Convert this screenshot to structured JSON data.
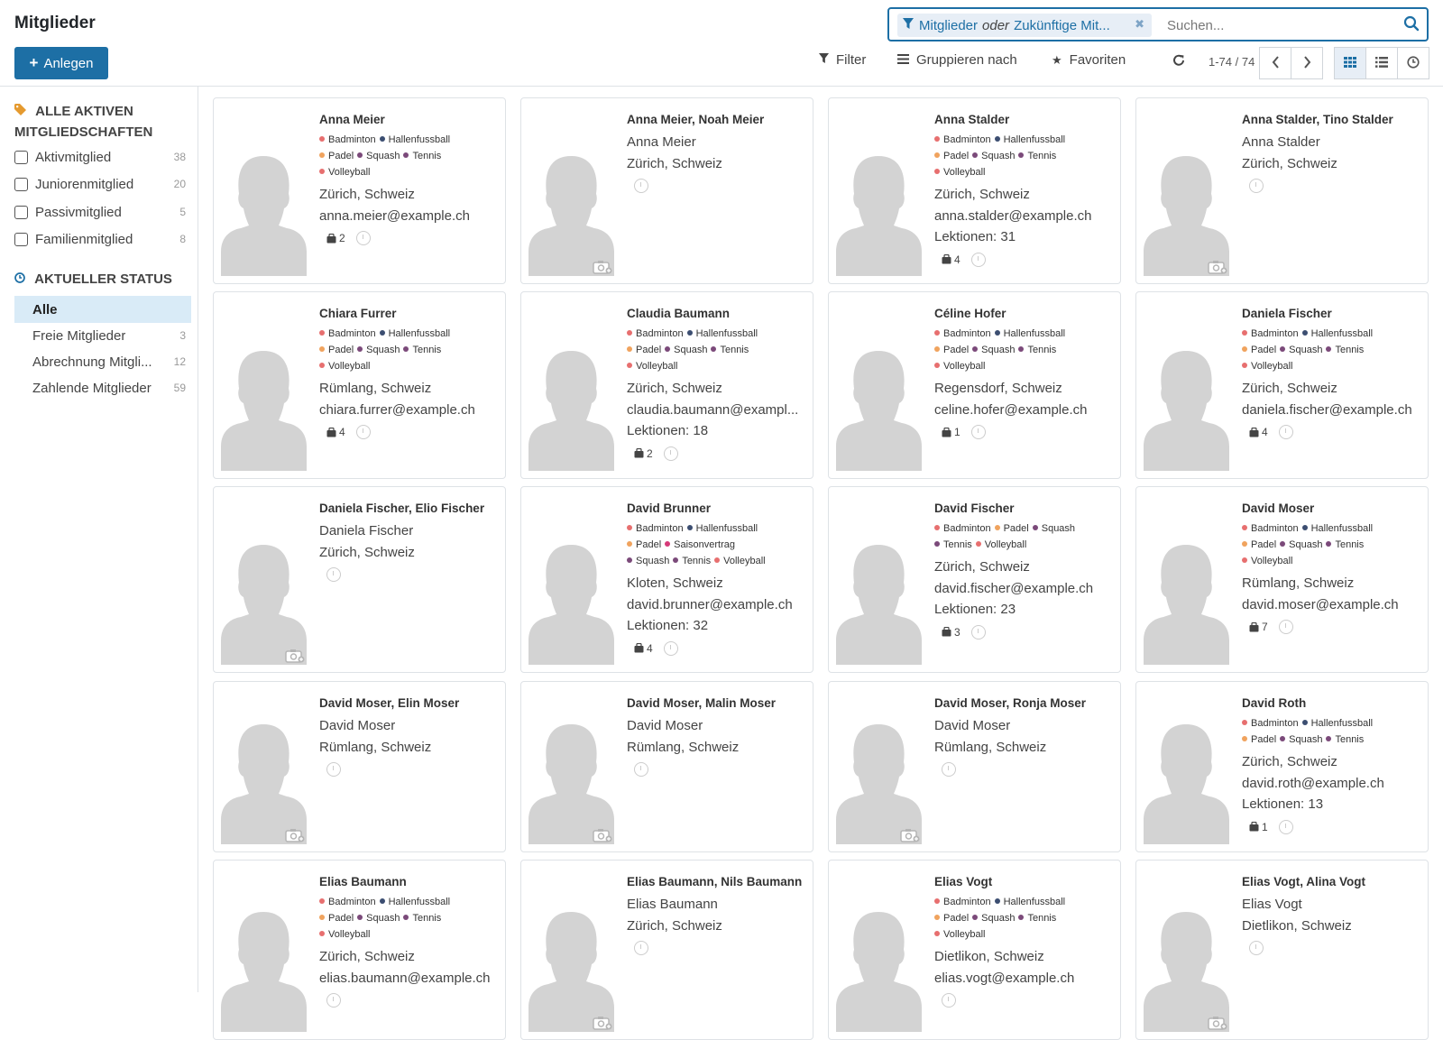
{
  "header": {
    "title": "Mitglieder",
    "create_label": "Anlegen",
    "facet_a": "Mitglieder",
    "facet_or": "oder",
    "facet_b": "Zukünftige Mit...",
    "search_placeholder": "Suchen...",
    "filter_label": "Filter",
    "group_label": "Gruppieren nach",
    "favorites_label": "Favoriten",
    "pager_value": "1-74 / 74"
  },
  "colors": {
    "accent": "#1d6fa5",
    "tag_red": "#e76f6f",
    "tag_orange": "#f0a35e",
    "tag_purple": "#7b4a7a",
    "tag_navy": "#3c4e71",
    "tag_magenta": "#d63a78"
  },
  "sidebar": {
    "memberships_title_1": "ALLE AKTIVEN",
    "memberships_title_2": "MITGLIEDSCHAFTEN",
    "memberships": [
      {
        "label": "Aktivmitglied",
        "count": "38"
      },
      {
        "label": "Juniorenmitglied",
        "count": "20"
      },
      {
        "label": "Passivmitglied",
        "count": "5"
      },
      {
        "label": "Familienmitglied",
        "count": "8"
      }
    ],
    "status_title": "AKTUELLER STATUS",
    "statuses": [
      {
        "label": "Alle",
        "count": ""
      },
      {
        "label": "Freie Mitglieder",
        "count": "3"
      },
      {
        "label": "Abrechnung Mitgli...",
        "count": "12"
      },
      {
        "label": "Zahlende Mitglieder",
        "count": "59"
      }
    ]
  },
  "cards": [
    {
      "name": "Anna Meier",
      "tags": [
        "Badminton",
        "Hallenfussball",
        "Padel",
        "Squash",
        "Tennis",
        "Volleyball"
      ],
      "lines": [
        "Zürich, Schweiz",
        "anna.meier@example.ch"
      ],
      "bag": "2",
      "camera": false
    },
    {
      "name": "Anna Meier, Noah Meier",
      "tags": [],
      "lines": [
        "Anna Meier",
        "Zürich, Schweiz"
      ],
      "bag": "",
      "camera": true
    },
    {
      "name": "Anna Stalder",
      "tags": [
        "Badminton",
        "Hallenfussball",
        "Padel",
        "Squash",
        "Tennis",
        "Volleyball"
      ],
      "lines": [
        "Zürich, Schweiz",
        "anna.stalder@example.ch",
        "Lektionen: 31"
      ],
      "bag": "4",
      "camera": false
    },
    {
      "name": "Anna Stalder, Tino Stalder",
      "tags": [],
      "lines": [
        "Anna Stalder",
        "Zürich, Schweiz"
      ],
      "bag": "",
      "camera": true
    },
    {
      "name": "Chiara Furrer",
      "tags": [
        "Badminton",
        "Hallenfussball",
        "Padel",
        "Squash",
        "Tennis",
        "Volleyball"
      ],
      "lines": [
        "Rümlang, Schweiz",
        "chiara.furrer@example.ch"
      ],
      "bag": "4",
      "camera": false
    },
    {
      "name": "Claudia Baumann",
      "tags": [
        "Badminton",
        "Hallenfussball",
        "Padel",
        "Squash",
        "Tennis",
        "Volleyball"
      ],
      "lines": [
        "Zürich, Schweiz",
        "claudia.baumann@exampl...",
        "Lektionen: 18"
      ],
      "bag": "2",
      "camera": false
    },
    {
      "name": "Céline Hofer",
      "tags": [
        "Badminton",
        "Hallenfussball",
        "Padel",
        "Squash",
        "Tennis",
        "Volleyball"
      ],
      "lines": [
        "Regensdorf, Schweiz",
        "celine.hofer@example.ch"
      ],
      "bag": "1",
      "camera": false
    },
    {
      "name": "Daniela Fischer",
      "tags": [
        "Badminton",
        "Hallenfussball",
        "Padel",
        "Squash",
        "Tennis",
        "Volleyball"
      ],
      "lines": [
        "Zürich, Schweiz",
        "daniela.fischer@example.ch"
      ],
      "bag": "4",
      "camera": false
    },
    {
      "name": "Daniela Fischer, Elio Fischer",
      "tags": [],
      "lines": [
        "Daniela Fischer",
        "Zürich, Schweiz"
      ],
      "bag": "",
      "camera": true
    },
    {
      "name": "David Brunner",
      "tags": [
        "Badminton",
        "Hallenfussball",
        "Padel",
        "Saisonvertrag",
        "Squash",
        "Tennis",
        "Volleyball"
      ],
      "lines": [
        "Kloten, Schweiz",
        "david.brunner@example.ch",
        "Lektionen: 32"
      ],
      "bag": "4",
      "camera": false
    },
    {
      "name": "David Fischer",
      "tags": [
        "Badminton",
        "Padel",
        "Squash",
        "Tennis",
        "Volleyball"
      ],
      "lines": [
        "Zürich, Schweiz",
        "david.fischer@example.ch",
        "Lektionen: 23"
      ],
      "bag": "3",
      "camera": false
    },
    {
      "name": "David Moser",
      "tags": [
        "Badminton",
        "Hallenfussball",
        "Padel",
        "Squash",
        "Tennis",
        "Volleyball"
      ],
      "lines": [
        "Rümlang, Schweiz",
        "david.moser@example.ch"
      ],
      "bag": "7",
      "camera": false
    },
    {
      "name": "David Moser, Elin Moser",
      "tags": [],
      "lines": [
        "David Moser",
        "Rümlang, Schweiz"
      ],
      "bag": "",
      "camera": true
    },
    {
      "name": "David Moser, Malin Moser",
      "tags": [],
      "lines": [
        "David Moser",
        "Rümlang, Schweiz"
      ],
      "bag": "",
      "camera": true
    },
    {
      "name": "David Moser, Ronja Moser",
      "tags": [],
      "lines": [
        "David Moser",
        "Rümlang, Schweiz"
      ],
      "bag": "",
      "camera": true
    },
    {
      "name": "David Roth",
      "tags": [
        "Badminton",
        "Hallenfussball",
        "Padel",
        "Squash",
        "Tennis"
      ],
      "lines": [
        "Zürich, Schweiz",
        "david.roth@example.ch",
        "Lektionen: 13"
      ],
      "bag": "1",
      "camera": false
    },
    {
      "name": "Elias Baumann",
      "tags": [
        "Badminton",
        "Hallenfussball",
        "Padel",
        "Squash",
        "Tennis",
        "Volleyball"
      ],
      "lines": [
        "Zürich, Schweiz",
        "elias.baumann@example.ch"
      ],
      "bag": "",
      "camera": false
    },
    {
      "name": "Elias Baumann, Nils Baumann",
      "tags": [],
      "lines": [
        "Elias Baumann",
        "Zürich, Schweiz"
      ],
      "bag": "",
      "camera": true
    },
    {
      "name": "Elias Vogt",
      "tags": [
        "Badminton",
        "Hallenfussball",
        "Padel",
        "Squash",
        "Tennis",
        "Volleyball"
      ],
      "lines": [
        "Dietlikon, Schweiz",
        "elias.vogt@example.ch"
      ],
      "bag": "",
      "camera": false
    },
    {
      "name": "Elias Vogt, Alina Vogt",
      "tags": [],
      "lines": [
        "Elias Vogt",
        "Dietlikon, Schweiz"
      ],
      "bag": "",
      "camera": true
    }
  ]
}
